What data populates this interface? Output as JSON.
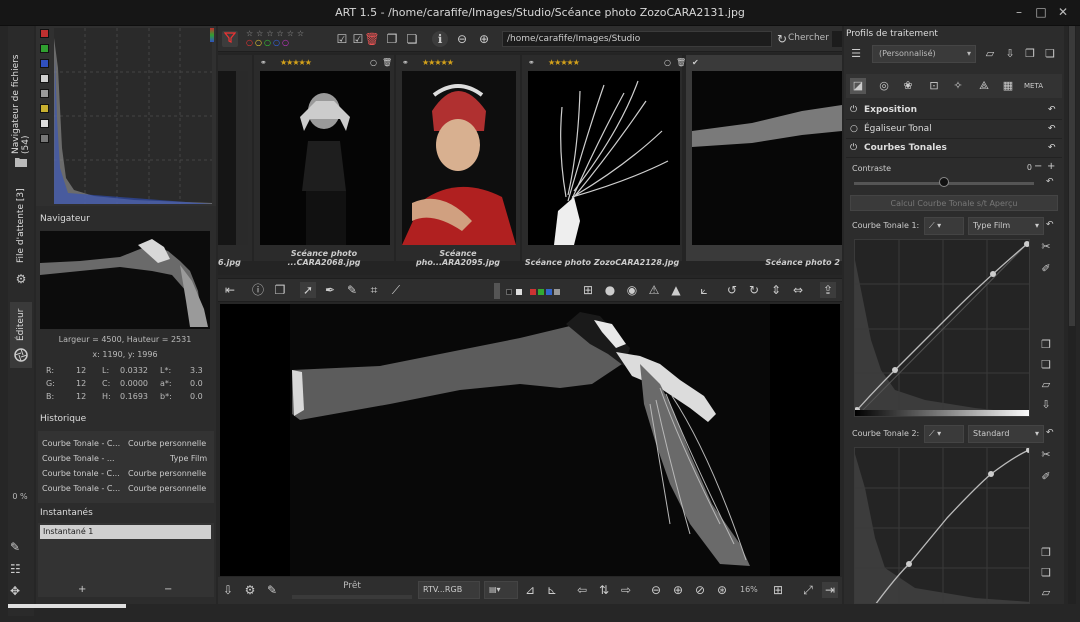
{
  "window": {
    "title": "ART 1.5 - /home/carafife/Images/Studio/Scéance photo ZozoCARA2131.jpg",
    "minimize": "–",
    "maximize": "□",
    "close": "✕"
  },
  "left_tabs": {
    "file_browser": "Navigateur de fichiers (54)",
    "queue": "File d'attente [3]",
    "editor": "Éditeur",
    "queue_percent": "0 %"
  },
  "navigator": {
    "title": "Navigateur",
    "size_text": "Largeur = 4500, Hauteur = 2531",
    "coords_text": "x: 1190, y: 1996",
    "rows": [
      {
        "a": "R:",
        "av": "12",
        "b": "L:",
        "bv": "0.0332",
        "c": "L*:",
        "cv": "3.3"
      },
      {
        "a": "G:",
        "av": "12",
        "b": "C:",
        "bv": "0.0000",
        "c": "a*:",
        "cv": "0.0"
      },
      {
        "a": "B:",
        "av": "12",
        "b": "H:",
        "bv": "0.1693",
        "c": "b*:",
        "cv": "0.0"
      }
    ]
  },
  "history": {
    "title": "Historique",
    "rows": [
      {
        "name": "Courbe Tonale - C...",
        "value": "Courbe personnelle"
      },
      {
        "name": "Courbe Tonale - ...",
        "value": "Type Film"
      },
      {
        "name": "Courbe tonale - C...",
        "value": "Courbe personnelle"
      },
      {
        "name": "Courbe Tonale - C...",
        "value": "Courbe personnelle"
      }
    ]
  },
  "snapshots": {
    "title": "Instantanés",
    "items": [
      "Instantané 1"
    ],
    "add": "+",
    "remove": "−"
  },
  "toolbar": {
    "path": "/home/carafife/Images/Studio",
    "search_label": "Chercher :"
  },
  "filmstrip": {
    "thumbs": [
      {
        "caption": "6.jpg",
        "stars": "★★★★★"
      },
      {
        "caption": "Scéance photo ...CARA2068.jpg",
        "stars": "★★★★★"
      },
      {
        "caption": "Scéance pho...ARA2095.jpg",
        "stars": "★★★★★"
      },
      {
        "caption": "Scéance photo ZozoCARA2128.jpg",
        "stars": "★★★★★"
      },
      {
        "caption": "Scéance photo 2",
        "stars": ""
      }
    ]
  },
  "editor_bottom": {
    "status": "Prêt",
    "profile_combo": "RTV...RGB",
    "zoom": "16%"
  },
  "right_panel": {
    "title": "Profils de traitement",
    "profile": "(Personnalisé)",
    "sections": [
      {
        "label": "Exposition"
      },
      {
        "label": "Égaliseur Tonal"
      },
      {
        "label": "Courbes Tonales"
      }
    ],
    "contrast_label": "Contraste",
    "contrast_value": "0",
    "contrast_level": 0.5,
    "calc_button": "Calcul Courbe Tonale s/t Aperçu",
    "curve1_label": "Courbe Tonale 1:",
    "curve1_type": "Type Film",
    "curve2_label": "Courbe Tonale 2:",
    "curve2_type": "Standard"
  },
  "colors": {
    "accent_star": "#d4a21b",
    "panel_bg": "#2c2c2c"
  }
}
